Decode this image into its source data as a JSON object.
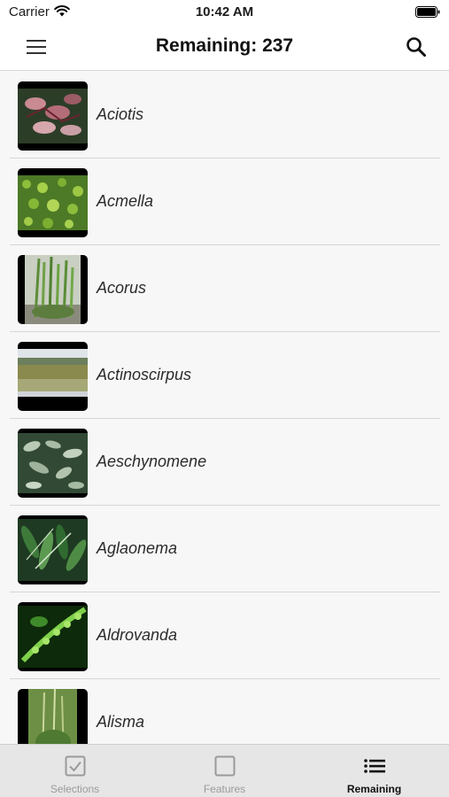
{
  "status_bar": {
    "carrier": "Carrier",
    "time": "10:42 AM"
  },
  "nav": {
    "title": "Remaining: 237",
    "menu_icon": "hamburger-menu-icon",
    "search_icon": "magnifier-icon"
  },
  "items": [
    {
      "label": "Aciotis",
      "thumb": "plant-photo"
    },
    {
      "label": "Acmella",
      "thumb": "plant-photo"
    },
    {
      "label": "Acorus",
      "thumb": "plant-photo"
    },
    {
      "label": "Actinoscirpus",
      "thumb": "plant-photo"
    },
    {
      "label": "Aeschynomene",
      "thumb": "plant-photo"
    },
    {
      "label": "Aglaonema",
      "thumb": "plant-photo"
    },
    {
      "label": "Aldrovanda",
      "thumb": "plant-photo"
    },
    {
      "label": "Alisma",
      "thumb": "plant-photo"
    }
  ],
  "tabs": [
    {
      "label": "Selections",
      "icon": "checkbox-checked-icon",
      "active": false
    },
    {
      "label": "Features",
      "icon": "checkbox-empty-icon",
      "active": false
    },
    {
      "label": "Remaining",
      "icon": "list-icon",
      "active": true
    }
  ],
  "colors": {
    "active_tab": "#111111",
    "inactive_tab": "#9a9a9a",
    "list_background": "#f7f7f7",
    "tab_bar_background": "#e6e6e6"
  }
}
